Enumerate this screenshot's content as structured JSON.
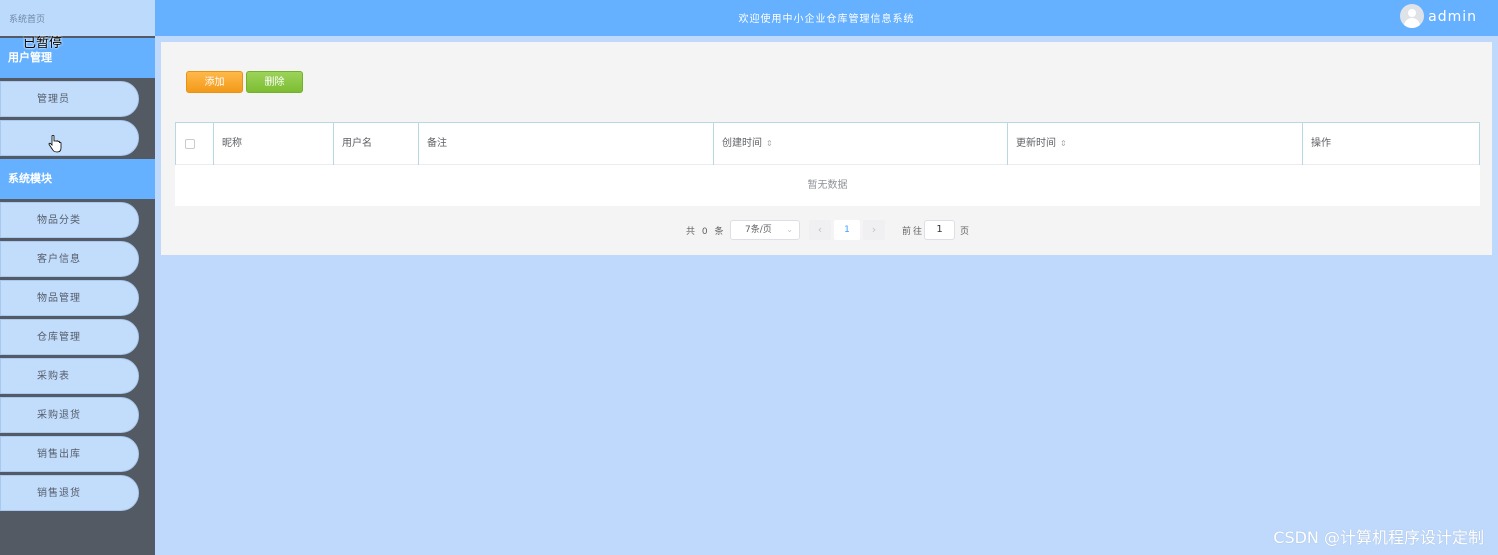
{
  "sidebar": {
    "home": "系统首页",
    "groups": [
      {
        "title": "用户管理",
        "items": [
          "管理员",
          ""
        ]
      },
      {
        "title": "系统模块",
        "items": [
          "物品分类",
          "客户信息",
          "物品管理",
          "仓库管理",
          "采购表",
          "采购退货",
          "销售出库",
          "销售退货"
        ]
      }
    ],
    "overlay": "已暂停"
  },
  "header": {
    "title": "欢迎使用中小企业仓库管理信息系统",
    "user": "admin"
  },
  "toolbar": {
    "add_label": "添加",
    "delete_label": "删除"
  },
  "table": {
    "columns": [
      "昵称",
      "用户名",
      "备注",
      "创建时间",
      "更新时间",
      "操作"
    ],
    "sortable": [
      false,
      false,
      false,
      true,
      true,
      false
    ],
    "empty_text": "暂无数据"
  },
  "pagination": {
    "total_text": "共 0 条",
    "page_size": "7条/页",
    "current_page": "1",
    "goto_label": "前往",
    "goto_value": "1",
    "page_label": "页",
    "prev_icon": "‹",
    "next_icon": "›"
  },
  "watermark": "CSDN @计算机程序设计定制",
  "colors": {
    "accent": "#66b1ff",
    "sidebar": "#535a63",
    "background": "#bed9fc",
    "add": "#f39a19",
    "delete": "#7dbd32"
  }
}
